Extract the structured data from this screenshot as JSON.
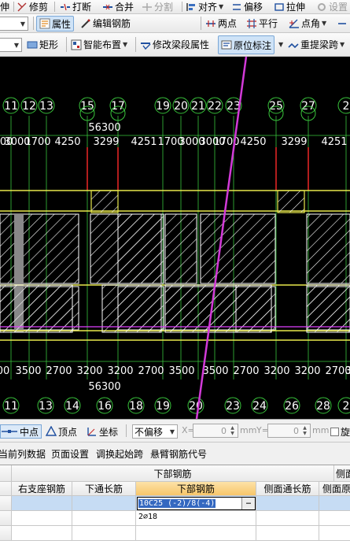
{
  "toolbar1": {
    "items": [
      "伸",
      "修剪",
      "打断",
      "合并",
      "分割",
      "对齐",
      "偏移",
      "拉伸",
      "设置"
    ]
  },
  "toolbar2": {
    "attr_label": "属性",
    "edit_rebar_label": "编辑钢筋",
    "two_point_label": "两点",
    "parallel_label": "平行",
    "point_angle_label": "点角"
  },
  "toolbar3": {
    "rect_label": "矩形",
    "smart_layout_label": "智能布置",
    "modify_span_label": "修改梁段属性",
    "in_situ_label": "原位标注",
    "reextract_label": "重提梁跨"
  },
  "canvas": {
    "colors": {
      "background": "#000000",
      "axis": "#39c43c",
      "dim_text": "#ffffff",
      "beam": "#e8e84c",
      "hatch": "#ffffff",
      "red": "#ff2a2a",
      "magenta": "#e040ff",
      "arrow": "#d23ad8"
    },
    "top_axes": [
      "11",
      "12",
      "13",
      "15",
      "17",
      "19",
      "20",
      "21",
      "22",
      "23",
      "25",
      "27",
      "2"
    ],
    "top_dim_total": "56300",
    "top_dims": [
      "300",
      "3000",
      "1700",
      "4250",
      "3299",
      "4251",
      "1700",
      "3000",
      "3000",
      "1700",
      "4250",
      "3299",
      "4251"
    ],
    "bottom_dims": [
      "00",
      "3500",
      "2700",
      "3200",
      "3200",
      "2700",
      "3500",
      "3500",
      "2700",
      "3200",
      "3200",
      "2700",
      "3"
    ],
    "bottom_dim_total": "56300",
    "bottom_axes": [
      "11",
      "13",
      "14",
      "16",
      "18",
      "19",
      "20",
      "23",
      "24",
      "26",
      "28",
      "2"
    ]
  },
  "statusbar": {
    "midpoint_label": "中点",
    "vertex_label": "顶点",
    "coord_label": "坐标",
    "offset_select": "不偏移",
    "x_label": "X=",
    "x_value": "0",
    "x_unit": "mm",
    "y_label": "Y=",
    "y_value": "0",
    "y_unit": "mm",
    "rotate_label": "旋"
  },
  "menubar2": {
    "items": [
      "当前列数据",
      "页面设置",
      "调换起始跨",
      "悬臂钢筋代号"
    ]
  },
  "grid": {
    "group_headers": {
      "bottom_rebar": "下部钢筋",
      "side": "侧面"
    },
    "columns": [
      "右支座钢筋",
      "下通长筋",
      "下部钢筋",
      "侧面通长筋",
      "侧面原"
    ],
    "edit_value": "10C25 (-2)/8(-4)",
    "edit_button": "…",
    "row2_value": "2⌀18"
  }
}
